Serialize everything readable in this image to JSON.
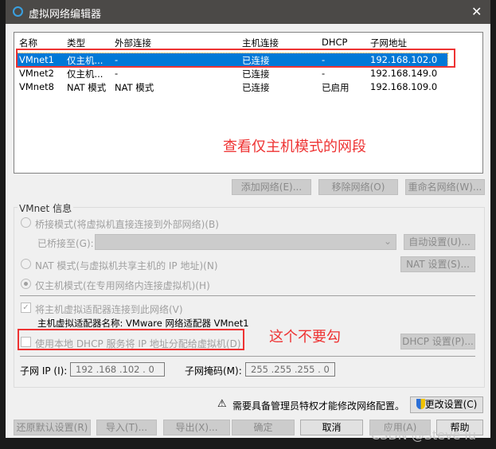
{
  "window": {
    "title": "虚拟网络编辑器",
    "close": "✕"
  },
  "table": {
    "headers": [
      "名称",
      "类型",
      "外部连接",
      "主机连接",
      "DHCP",
      "子网地址"
    ],
    "rows": [
      [
        "VMnet1",
        "仅主机...",
        "-",
        "已连接",
        "-",
        "192.168.102.0"
      ],
      [
        "VMnet2",
        "仅主机...",
        "-",
        "已连接",
        "-",
        "192.168.149.0"
      ],
      [
        "VMnet8",
        "NAT 模式",
        "NAT 模式",
        "已连接",
        "已启用",
        "192.168.109.0"
      ]
    ],
    "selected_index": 0
  },
  "annotations": {
    "subnet_note": "查看仅主机模式的网段",
    "dhcp_note": "这个不要勾"
  },
  "net_buttons": {
    "add": "添加网络(E)...",
    "remove": "移除网络(O)",
    "rename": "重命名网络(W)..."
  },
  "info": {
    "group_label": "VMnet 信息",
    "bridge_mode": "桥接模式(将虚拟机直接连接到外部网络)(B)",
    "bridged_to_label": "已桥接至(G):",
    "auto_settings": "自动设置(U)...",
    "nat_mode": "NAT 模式(与虚拟机共享主机的 IP 地址)(N)",
    "nat_settings": "NAT 设置(S)...",
    "host_only_mode": "仅主机模式(在专用网络内连接虚拟机)(H)",
    "connect_adapter": "将主机虚拟适配器连接到此网络(V)",
    "adapter_name": "主机虚拟适配器名称: VMware 网络适配器 VMnet1",
    "use_dhcp": "使用本地 DHCP 服务将 IP 地址分配给虚拟机(D)",
    "dhcp_settings": "DHCP 设置(P)...",
    "subnet_ip_label": "子网 IP (I):",
    "subnet_ip": "192 .168 .102 .  0",
    "subnet_mask_label": "子网掩码(M):",
    "subnet_mask": "255 .255 .255 .  0"
  },
  "admin": {
    "warning": "需要具备管理员特权才能修改网络配置。",
    "change_settings": "更改设置(C)"
  },
  "footer": {
    "restore": "还原默认设置(R)",
    "import": "导入(T)...",
    "export": "导出(X)...",
    "ok": "确定",
    "cancel": "取消",
    "apply": "应用(A)",
    "help": "帮助"
  },
  "watermark": "CSDN @Steve lu",
  "colors": {
    "selection": "#0078d7",
    "annotation": "#ee3333",
    "titlebar": "#4b4947"
  }
}
